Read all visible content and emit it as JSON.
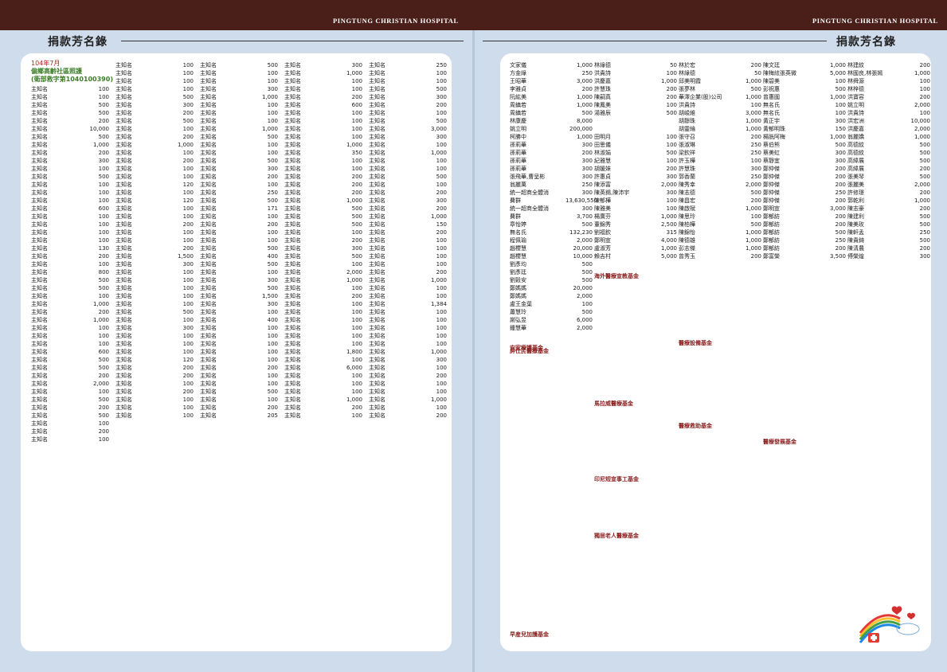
{
  "header": {
    "hospital_left": "PINGTUNG CHRISTIAN HOSPITAL",
    "hospital_right": "PINGTUNG CHRISTIAN HOSPITAL",
    "title_left": "捐款芳名錄",
    "title_right": "捐款芳名錄"
  },
  "intro": {
    "month": "104年7月",
    "line1": "偏鄉高齡社區照護",
    "line2": "(衛部救字第1040100390)"
  },
  "colors": {
    "topbar": "#4a1f1a",
    "background": "#cfdcec",
    "panel": "#ffffff",
    "section_heading": "#8a1f1f",
    "intro_red": "#b5261e",
    "intro_green": "#3e7c2a"
  },
  "decoration_icons": [
    "rainbow-icon",
    "heart-icon",
    "medical-cross-icon"
  ],
  "left_columns": [
    [
      [
        "主知名",
        "100"
      ],
      [
        "主知名",
        "100"
      ],
      [
        "主知名",
        "500"
      ],
      [
        "主知名",
        "500"
      ],
      [
        "主知名",
        "200"
      ],
      [
        "主知名",
        "10,000"
      ],
      [
        "主知名",
        "500"
      ],
      [
        "主知名",
        "1,000"
      ],
      [
        "主知名",
        "200"
      ],
      [
        "主知名",
        "300"
      ],
      [
        "主知名",
        "100"
      ],
      [
        "主知名",
        "500"
      ],
      [
        "主知名",
        "100"
      ],
      [
        "主知名",
        "100"
      ],
      [
        "主知名",
        "100"
      ],
      [
        "主知名",
        "600"
      ],
      [
        "主知名",
        "100"
      ],
      [
        "主知名",
        "100"
      ],
      [
        "主知名",
        "100"
      ],
      [
        "主知名",
        "100"
      ],
      [
        "主知名",
        "130"
      ],
      [
        "主知名",
        "200"
      ],
      [
        "主知名",
        "100"
      ],
      [
        "主知名",
        "800"
      ],
      [
        "主知名",
        "500"
      ],
      [
        "主知名",
        "500"
      ],
      [
        "主知名",
        "100"
      ],
      [
        "主知名",
        "1,000"
      ],
      [
        "主知名",
        "200"
      ],
      [
        "主知名",
        "1,000"
      ],
      [
        "主知名",
        "100"
      ],
      [
        "主知名",
        "100"
      ],
      [
        "主知名",
        "100"
      ],
      [
        "主知名",
        "600"
      ],
      [
        "主知名",
        "500"
      ],
      [
        "主知名",
        "500"
      ],
      [
        "主知名",
        "200"
      ],
      [
        "主知名",
        "2,000"
      ],
      [
        "主知名",
        "100"
      ],
      [
        "主知名",
        "500"
      ],
      [
        "主知名",
        "200"
      ],
      [
        "主知名",
        "500"
      ],
      [
        "主知名",
        "100"
      ],
      [
        "主知名",
        "200"
      ],
      [
        "主知名",
        "100"
      ]
    ],
    [
      [
        "主知名",
        "100"
      ],
      [
        "主知名",
        "100"
      ],
      [
        "主知名",
        "100"
      ],
      [
        "主知名",
        "100"
      ],
      [
        "主知名",
        "500"
      ],
      [
        "主知名",
        "300"
      ],
      [
        "主知名",
        "200"
      ],
      [
        "主知名",
        "500"
      ],
      [
        "主知名",
        "100"
      ],
      [
        "主知名",
        "200"
      ],
      [
        "主知名",
        "1,000"
      ],
      [
        "主知名",
        "100"
      ],
      [
        "主知名",
        "200"
      ],
      [
        "主知名",
        "100"
      ],
      [
        "主知名",
        "100"
      ],
      [
        "主知名",
        "120"
      ],
      [
        "主知名",
        "100"
      ],
      [
        "主知名",
        "120"
      ],
      [
        "主知名",
        "100"
      ],
      [
        "主知名",
        "100"
      ],
      [
        "主知名",
        "200"
      ],
      [
        "主知名",
        "100"
      ],
      [
        "主知名",
        "100"
      ],
      [
        "主知名",
        "200"
      ],
      [
        "主知名",
        "1,500"
      ],
      [
        "主知名",
        "300"
      ],
      [
        "主知名",
        "100"
      ],
      [
        "主知名",
        "100"
      ],
      [
        "主知名",
        "100"
      ],
      [
        "主知名",
        "100"
      ],
      [
        "主知名",
        "100"
      ],
      [
        "主知名",
        "500"
      ],
      [
        "主知名",
        "100"
      ],
      [
        "主知名",
        "300"
      ],
      [
        "主知名",
        "100"
      ],
      [
        "主知名",
        "100"
      ],
      [
        "主知名",
        "100"
      ],
      [
        "主知名",
        "120"
      ],
      [
        "主知名",
        "200"
      ],
      [
        "主知名",
        "200"
      ],
      [
        "主知名",
        "100"
      ],
      [
        "主知名",
        "200"
      ],
      [
        "主知名",
        "100"
      ],
      [
        "主知名",
        "100"
      ],
      [
        "主知名",
        "100"
      ]
    ],
    [
      [
        "主知名",
        "500"
      ],
      [
        "主知名",
        "100"
      ],
      [
        "主知名",
        "100"
      ],
      [
        "主知名",
        "300"
      ],
      [
        "主知名",
        "1,000"
      ],
      [
        "主知名",
        "100"
      ],
      [
        "主知名",
        "100"
      ],
      [
        "主知名",
        "100"
      ],
      [
        "主知名",
        "1,000"
      ],
      [
        "主知名",
        "500"
      ],
      [
        "主知名",
        "100"
      ],
      [
        "主知名",
        "100"
      ],
      [
        "主知名",
        "500"
      ],
      [
        "主知名",
        "300"
      ],
      [
        "主知名",
        "200"
      ],
      [
        "主知名",
        "100"
      ],
      [
        "主知名",
        "250"
      ],
      [
        "主知名",
        "500"
      ],
      [
        "主知名",
        "171"
      ],
      [
        "主知名",
        "100"
      ],
      [
        "主知名",
        "200"
      ],
      [
        "主知名",
        "100"
      ],
      [
        "主知名",
        "100"
      ],
      [
        "主知名",
        "500"
      ],
      [
        "主知名",
        "400"
      ],
      [
        "主知名",
        "500"
      ],
      [
        "主知名",
        "100"
      ],
      [
        "主知名",
        "300"
      ],
      [
        "主知名",
        "500"
      ],
      [
        "主知名",
        "1,500"
      ],
      [
        "主知名",
        "300"
      ],
      [
        "主知名",
        "100"
      ],
      [
        "主知名",
        "400"
      ],
      [
        "主知名",
        "100"
      ],
      [
        "主知名",
        "100"
      ],
      [
        "主知名",
        "100"
      ],
      [
        "主知名",
        "100"
      ],
      [
        "主知名",
        "100"
      ],
      [
        "主知名",
        "200"
      ],
      [
        "主知名",
        "100"
      ],
      [
        "主知名",
        "100"
      ],
      [
        "主知名",
        "500"
      ],
      [
        "主知名",
        "100"
      ],
      [
        "主知名",
        "200"
      ],
      [
        "主知名",
        "205"
      ]
    ],
    [
      [
        "主知名",
        "300"
      ],
      [
        "主知名",
        "1,000"
      ],
      [
        "主知名",
        "100"
      ],
      [
        "主知名",
        "100"
      ],
      [
        "主知名",
        "200"
      ],
      [
        "主知名",
        "600"
      ],
      [
        "主知名",
        "100"
      ],
      [
        "主知名",
        "100"
      ],
      [
        "主知名",
        "100"
      ],
      [
        "主知名",
        "100"
      ],
      [
        "主知名",
        "1,000"
      ],
      [
        "主知名",
        "350"
      ],
      [
        "主知名",
        "100"
      ],
      [
        "主知名",
        "100"
      ],
      [
        "主知名",
        "200"
      ],
      [
        "主知名",
        "200"
      ],
      [
        "主知名",
        "200"
      ],
      [
        "主知名",
        "1,000"
      ],
      [
        "主知名",
        "500"
      ],
      [
        "主知名",
        "500"
      ],
      [
        "主知名",
        "500"
      ],
      [
        "主知名",
        "100"
      ],
      [
        "主知名",
        "200"
      ],
      [
        "主知名",
        "300"
      ],
      [
        "主知名",
        "500"
      ],
      [
        "主知名",
        "100"
      ],
      [
        "主知名",
        "2,000"
      ],
      [
        "主知名",
        "1,000"
      ],
      [
        "主知名",
        "100"
      ],
      [
        "主知名",
        "200"
      ],
      [
        "主知名",
        "100"
      ],
      [
        "主知名",
        "100"
      ],
      [
        "主知名",
        "100"
      ],
      [
        "主知名",
        "100"
      ],
      [
        "主知名",
        "100"
      ],
      [
        "主知名",
        "100"
      ],
      [
        "主知名",
        "1,800"
      ],
      [
        "主知名",
        "100"
      ],
      [
        "主知名",
        "6,000"
      ],
      [
        "主知名",
        "100"
      ],
      [
        "主知名",
        "100"
      ],
      [
        "主知名",
        "100"
      ],
      [
        "主知名",
        "1,000"
      ],
      [
        "主知名",
        "200"
      ],
      [
        "主知名",
        "100"
      ]
    ],
    [
      [
        "主知名",
        "250"
      ],
      [
        "主知名",
        "100"
      ],
      [
        "主知名",
        "100"
      ],
      [
        "主知名",
        "500"
      ],
      [
        "主知名",
        "300"
      ],
      [
        "主知名",
        "200"
      ],
      [
        "主知名",
        "100"
      ],
      [
        "主知名",
        "500"
      ],
      [
        "主知名",
        "3,000"
      ],
      [
        "主知名",
        "300"
      ],
      [
        "主知名",
        "100"
      ],
      [
        "主知名",
        "1,000"
      ],
      [
        "主知名",
        "100"
      ],
      [
        "主知名",
        "100"
      ],
      [
        "主知名",
        "500"
      ],
      [
        "主知名",
        "100"
      ],
      [
        "主知名",
        "200"
      ],
      [
        "主知名",
        "300"
      ],
      [
        "主知名",
        "200"
      ],
      [
        "主知名",
        "1,000"
      ],
      [
        "主知名",
        "150"
      ],
      [
        "主知名",
        "200"
      ],
      [
        "主知名",
        "100"
      ],
      [
        "主知名",
        "100"
      ],
      [
        "主知名",
        "100"
      ],
      [
        "主知名",
        "100"
      ],
      [
        "主知名",
        "200"
      ],
      [
        "主知名",
        "1,000"
      ],
      [
        "主知名",
        "100"
      ],
      [
        "主知名",
        "100"
      ],
      [
        "主知名",
        "1,384"
      ],
      [
        "主知名",
        "100"
      ],
      [
        "主知名",
        "100"
      ],
      [
        "主知名",
        "100"
      ],
      [
        "主知名",
        "100"
      ],
      [
        "主知名",
        "100"
      ],
      [
        "主知名",
        "1,000"
      ],
      [
        "主知名",
        "300"
      ],
      [
        "主知名",
        "100"
      ],
      [
        "主知名",
        "200"
      ],
      [
        "主知名",
        "100"
      ],
      [
        "主知名",
        "100"
      ],
      [
        "主知名",
        "1,000"
      ],
      [
        "主知名",
        "100"
      ],
      [
        "主知名",
        "200"
      ]
    ]
  ],
  "right_columns": [
    [
      [
        "文家儀",
        "1,000"
      ],
      [
        "方金綠",
        "250"
      ],
      [
        "王昭華",
        "3,000"
      ],
      [
        "李雅貞",
        "200"
      ],
      [
        "阮紘美",
        "1,000"
      ],
      [
        "周鎮若",
        "1,000"
      ],
      [
        "周鎮若",
        "500"
      ],
      [
        "林康慶",
        "8,000"
      ],
      [
        "姚立明",
        "200,000"
      ],
      [
        "柯勝中",
        "1,000"
      ],
      [
        "孫莉華",
        "300"
      ],
      [
        "孫莉華",
        "200"
      ],
      [
        "孫莉華",
        "300"
      ],
      [
        "孫莉華",
        "300"
      ],
      [
        "張飛華,曹呈彬",
        "300"
      ],
      [
        "翁麗萬",
        "250"
      ],
      [
        "統一超商全體消",
        "300"
      ],
      [
        "費群",
        "13,630,550"
      ],
      [
        "統一超商全體消",
        "300"
      ],
      [
        "費群",
        "3,700"
      ],
      [
        "章怡婷",
        "500"
      ],
      [
        "無名氏",
        "132,230"
      ],
      [
        "程佩瑜",
        "2,000"
      ],
      [
        "趙櫻慧",
        "20,000"
      ],
      [
        "趙櫻慧",
        "10,000"
      ],
      [
        "劉彥均",
        "500"
      ],
      [
        "劉彥廷",
        "500"
      ],
      [
        "劉穀安",
        "500"
      ],
      [
        "鄭媽媽",
        "20,000"
      ],
      [
        "鄭媽媽",
        "2,000"
      ],
      [
        "盧王金葉",
        "100"
      ],
      [
        "蕭慧玲",
        "500"
      ],
      [
        "謝弘昱",
        "6,000"
      ],
      [
        "鍾慧華",
        "2,000"
      ]
    ],
    [
      [
        "林綠德",
        "50"
      ],
      [
        "洪貴詩",
        "100"
      ],
      [
        "洪慶嘉",
        "1,000"
      ],
      [
        "許慧珠",
        "200"
      ],
      [
        "陳嗣真",
        "200"
      ],
      [
        "陳鳳美",
        "100"
      ],
      [
        "湯雅辰",
        "500"
      ],
      [
        "",
        ""
      ],
      [
        "",
        ""
      ],
      [
        "田明月",
        "100"
      ],
      [
        "田思儀",
        "100"
      ],
      [
        "林淑娟",
        "500"
      ],
      [
        "紀雅慧",
        "100"
      ],
      [
        "胡媛妹",
        "200"
      ],
      [
        "許惠貞",
        "300"
      ],
      [
        "陳添富",
        "2,000"
      ],
      [
        "陳英錫,陳沛宇",
        "300"
      ],
      [
        "陳郁樺",
        "100"
      ],
      [
        "陳雅美",
        "100"
      ],
      [
        "楊廣芬",
        "1,000"
      ],
      [
        "董錦秀",
        "2,500"
      ],
      [
        "劉福欽",
        "315"
      ],
      [
        "鄭明宣",
        "4,000"
      ],
      [
        "盧淑芳",
        "1,000"
      ],
      [
        "賴吉村",
        "5,000"
      ]
    ],
    [
      [
        "林於宏",
        "200"
      ],
      [
        "林綠德",
        "50"
      ],
      [
        "邱美明霞",
        "1,000"
      ],
      [
        "張夢林",
        "500"
      ],
      [
        "華澤企業(股)公司",
        "1,000"
      ],
      [
        "洪貴詩",
        "100"
      ],
      [
        "胡峻維",
        "3,000"
      ],
      [
        "胡靜珠",
        "1,000"
      ],
      [
        "胡靈綸",
        "1,000"
      ],
      [
        "張守召",
        "200"
      ],
      [
        "張淑琳",
        "250"
      ],
      [
        "梁欽祥",
        "250"
      ],
      [
        "許玉樺",
        "100"
      ],
      [
        "許慧珠",
        "300"
      ],
      [
        "郭香蘭",
        "250"
      ],
      [
        "陳秀幸",
        "2,000"
      ],
      [
        "陳志德",
        "500"
      ],
      [
        "陳昌宏",
        "200"
      ],
      [
        "陳啟賦",
        "1,000"
      ],
      [
        "陳思玲",
        "100"
      ],
      [
        "陳柏樺",
        "500"
      ],
      [
        "陳錦怡",
        "1,000"
      ],
      [
        "陳德雄",
        "1,000"
      ],
      [
        "彭志傑",
        "1,000"
      ],
      [
        "曾秀玉",
        "200"
      ]
    ],
    [
      [
        "陳文廷",
        "1,000"
      ],
      [
        "陳梅絃張英微",
        "5,000"
      ],
      [
        "陳碧美",
        "100"
      ],
      [
        "彭祝惠",
        "500"
      ],
      [
        "曾惠國",
        "1,000"
      ],
      [
        "無名氏",
        "100"
      ],
      [
        "無名氏",
        "100"
      ],
      [
        "黃正宇",
        "300"
      ],
      [
        "黃郁明珠",
        "150"
      ],
      [
        "楊胱阿梅",
        "1,000"
      ],
      [
        "蔡伯熊",
        "500"
      ],
      [
        "蔡美虹",
        "300"
      ],
      [
        "蔡靜宜",
        "300"
      ],
      [
        "鄭仲傑",
        "200"
      ],
      [
        "鄭仲傑",
        "200"
      ],
      [
        "鄭仲傑",
        "200"
      ],
      [
        "鄭仲傑",
        "250"
      ],
      [
        "鄭仲傑",
        "200"
      ],
      [
        "鄭明宣",
        "3,000"
      ],
      [
        "鄭郁紡",
        "200"
      ],
      [
        "鄭郁紡",
        "200"
      ],
      [
        "鄭郁紡",
        "500"
      ],
      [
        "鄭郁紡",
        "250"
      ],
      [
        "鄭郁紡",
        "200"
      ],
      [
        "鄭富榮",
        "3,500"
      ]
    ],
    [
      [
        "林建紋",
        "200"
      ],
      [
        "林國良,林張嫣",
        "1,000"
      ],
      [
        "林舜源",
        "100"
      ],
      [
        "林梓德",
        "100"
      ],
      [
        "洪寶容",
        "200"
      ],
      [
        "姚立明",
        "2,000"
      ],
      [
        "洪貴詩",
        "100"
      ],
      [
        "洪宏洲",
        "10,000"
      ],
      [
        "洪慶嘉",
        "2,000"
      ],
      [
        "翁麗嬌",
        "1,000"
      ],
      [
        "高德紋",
        "500"
      ],
      [
        "高德紋",
        "500"
      ],
      [
        "高緯展",
        "500"
      ],
      [
        "高緯展",
        "200"
      ],
      [
        "張美琴",
        "500"
      ],
      [
        "張麗美",
        "2,000"
      ],
      [
        "許修璟",
        "200"
      ],
      [
        "郭乾利",
        "1,000"
      ],
      [
        "陳志豪",
        "200"
      ],
      [
        "陳建利",
        "500"
      ],
      [
        "陳美玫",
        "500"
      ],
      [
        "陳軒孟",
        "250"
      ],
      [
        "陳貴錡",
        "500"
      ],
      [
        "陳清農",
        "200"
      ],
      [
        "傅榮煌",
        "300"
      ]
    ]
  ],
  "right_sections": [
    "屏仕民醫療基金",
    "海外醫療宣教基金",
    "安家療護基金",
    "馬拉威醫療基金",
    "印尼短宣事工基金",
    "獨居老人醫療基金",
    "早産兒加護基金",
    "醫療救助基金",
    "醫療設備基金",
    "醫療發展基金"
  ]
}
